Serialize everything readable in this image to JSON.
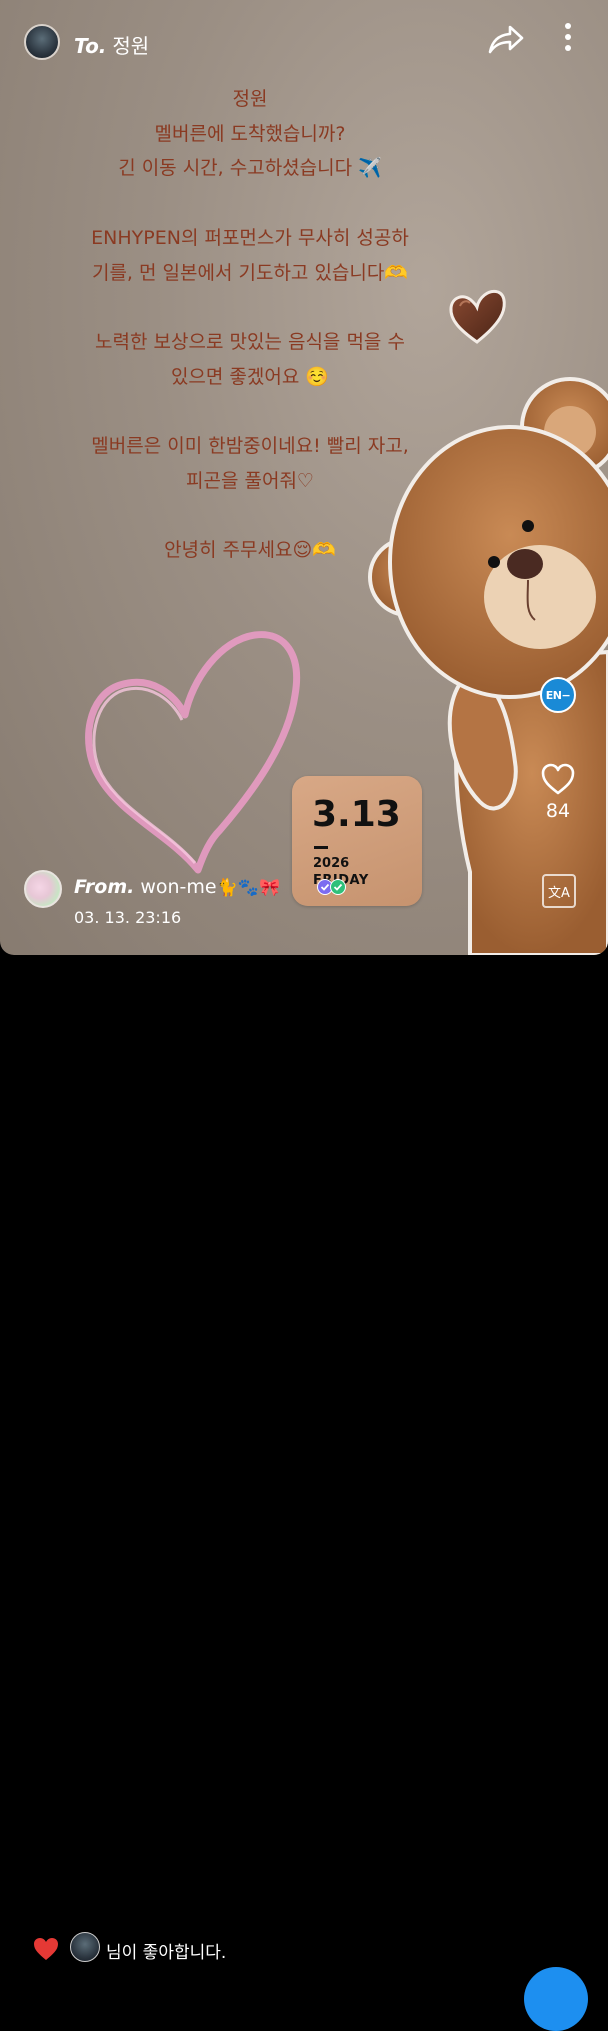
{
  "header": {
    "to_prefix": "To.",
    "recipient": "정원",
    "share_icon": "share-arrow-icon",
    "more_icon": "more-vertical-icon"
  },
  "message": {
    "text": "정원\n멜버른에 도착했습니까?\n긴 이동 시간, 수고하셨습니다 ✈️\n\nENHYPEN의 퍼포먼스가 무사히 성공하\n기를, 먼 일본에서 기도하고 있습니다🫶\n\n노력한 보상으로 맛있는 음식을 먹을 수\n있으면 좋겠어요 ☺️\n\n멜버른은 이미 한밤중이네요! 빨리 자고,\n피곤을 풀어줘♡\n\n안녕히 주무세요😌🫶",
    "text_color": "#8a3a22"
  },
  "date_card": {
    "date": "3.13",
    "year": "2026",
    "day": "FRIDAY"
  },
  "side_actions": {
    "badge_label": "EN−",
    "badge_color": "#1a8ad6",
    "like_count": "84",
    "translate_label": "文A"
  },
  "sender": {
    "from_prefix": "From.",
    "name": "won-me",
    "emojis": "🐈🐾🎀",
    "timestamp": "03. 13. 23:16"
  },
  "bottom_bar": {
    "like_text": "님이 좋아합니다.",
    "heart_color": "#e53935"
  }
}
